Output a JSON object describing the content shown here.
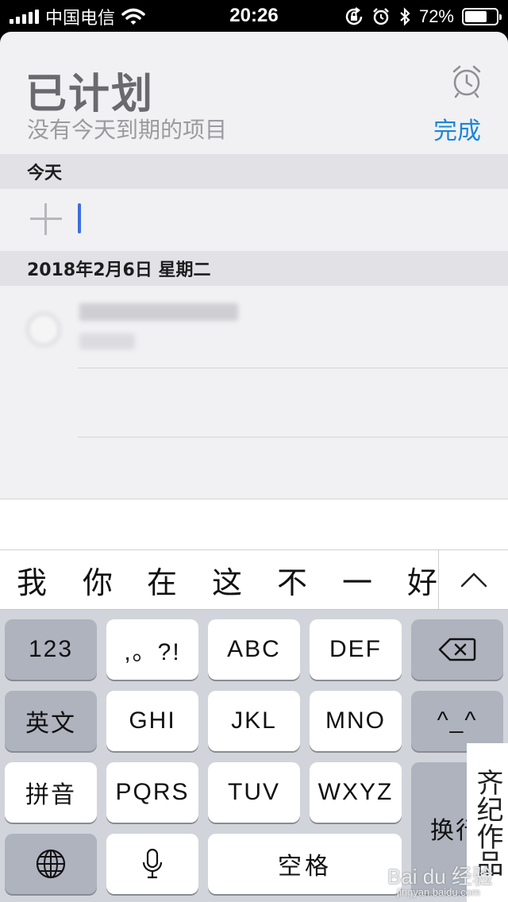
{
  "status_bar": {
    "carrier": "中国电信",
    "time": "20:26",
    "battery_percent": "72%",
    "battery_level": 0.72,
    "icons": [
      "signal-icon",
      "wifi-icon",
      "rotation-lock-icon",
      "alarm-icon",
      "bluetooth-icon",
      "battery-icon"
    ]
  },
  "reminders": {
    "title": "已计划",
    "subtitle": "没有今天到期的项目",
    "done_label": "完成",
    "alarm_icon": "alarm-clock-icon",
    "sections": [
      {
        "header": "今天"
      },
      {
        "header": "2018年2月6日 星期二"
      }
    ]
  },
  "candidates": {
    "words": [
      "我",
      "你",
      "在",
      "这",
      "不",
      "一",
      "好"
    ],
    "expand_icon": "chevron-up-icon"
  },
  "keyboard": {
    "row1": {
      "numbers": "123",
      "punct": ",。?!",
      "k1": "ABC",
      "k2": "DEF",
      "delete_icon": "backspace-icon"
    },
    "row2": {
      "english": "英文",
      "k1": "GHI",
      "k2": "JKL",
      "k3": "MNO",
      "emoticon": "^_^"
    },
    "row3": {
      "pinyin": "拼音",
      "k1": "PQRS",
      "k2": "TUV",
      "k3": "WXYZ",
      "return": "换行"
    },
    "row4": {
      "globe_icon": "globe-icon",
      "mic_icon": "microphone-icon",
      "space": "空格"
    }
  },
  "watermark": {
    "stamp": "齐纪作品",
    "logo": "Bai du 经验",
    "url": "jingyan.baidu.com"
  },
  "colors": {
    "accent": "#1c86d8",
    "cursor": "#3b6fe0",
    "section_bg": "#e2e2e6",
    "keyboard_bg": "#d1d4da"
  }
}
